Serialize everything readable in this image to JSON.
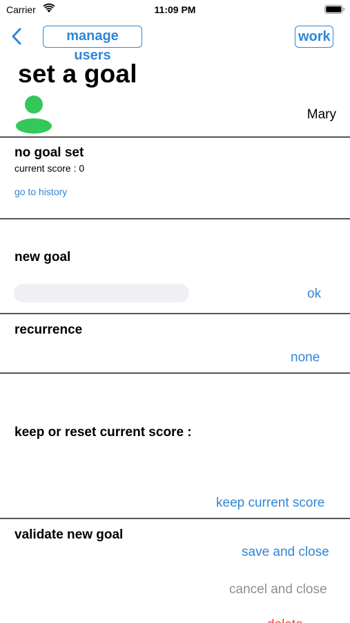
{
  "status_bar": {
    "carrier": "Carrier",
    "time": "11:09 PM"
  },
  "nav": {
    "back_icon": "chevron-left-icon",
    "manage_users": "manage users",
    "work": "work"
  },
  "title": "set a goal",
  "user": {
    "avatar_icon": "person-icon",
    "name": "Mary",
    "avatar_color": "#34c759"
  },
  "goal_summary": {
    "status": "no goal set",
    "current_score": "current score : 0",
    "history_link": "go to history"
  },
  "new_goal": {
    "label": "new goal",
    "input_value": "",
    "ok": "ok"
  },
  "recurrence": {
    "label": "recurrence",
    "value": "none"
  },
  "score_option": {
    "label": "keep or reset current score :",
    "value": "keep current score"
  },
  "validate": {
    "label": "validate new goal",
    "save": "save and close",
    "cancel": "cancel and close",
    "delete": "delete"
  },
  "colors": {
    "accent": "#2f86d6",
    "disabled": "#8e8e93",
    "destructive": "#ff3b30"
  }
}
